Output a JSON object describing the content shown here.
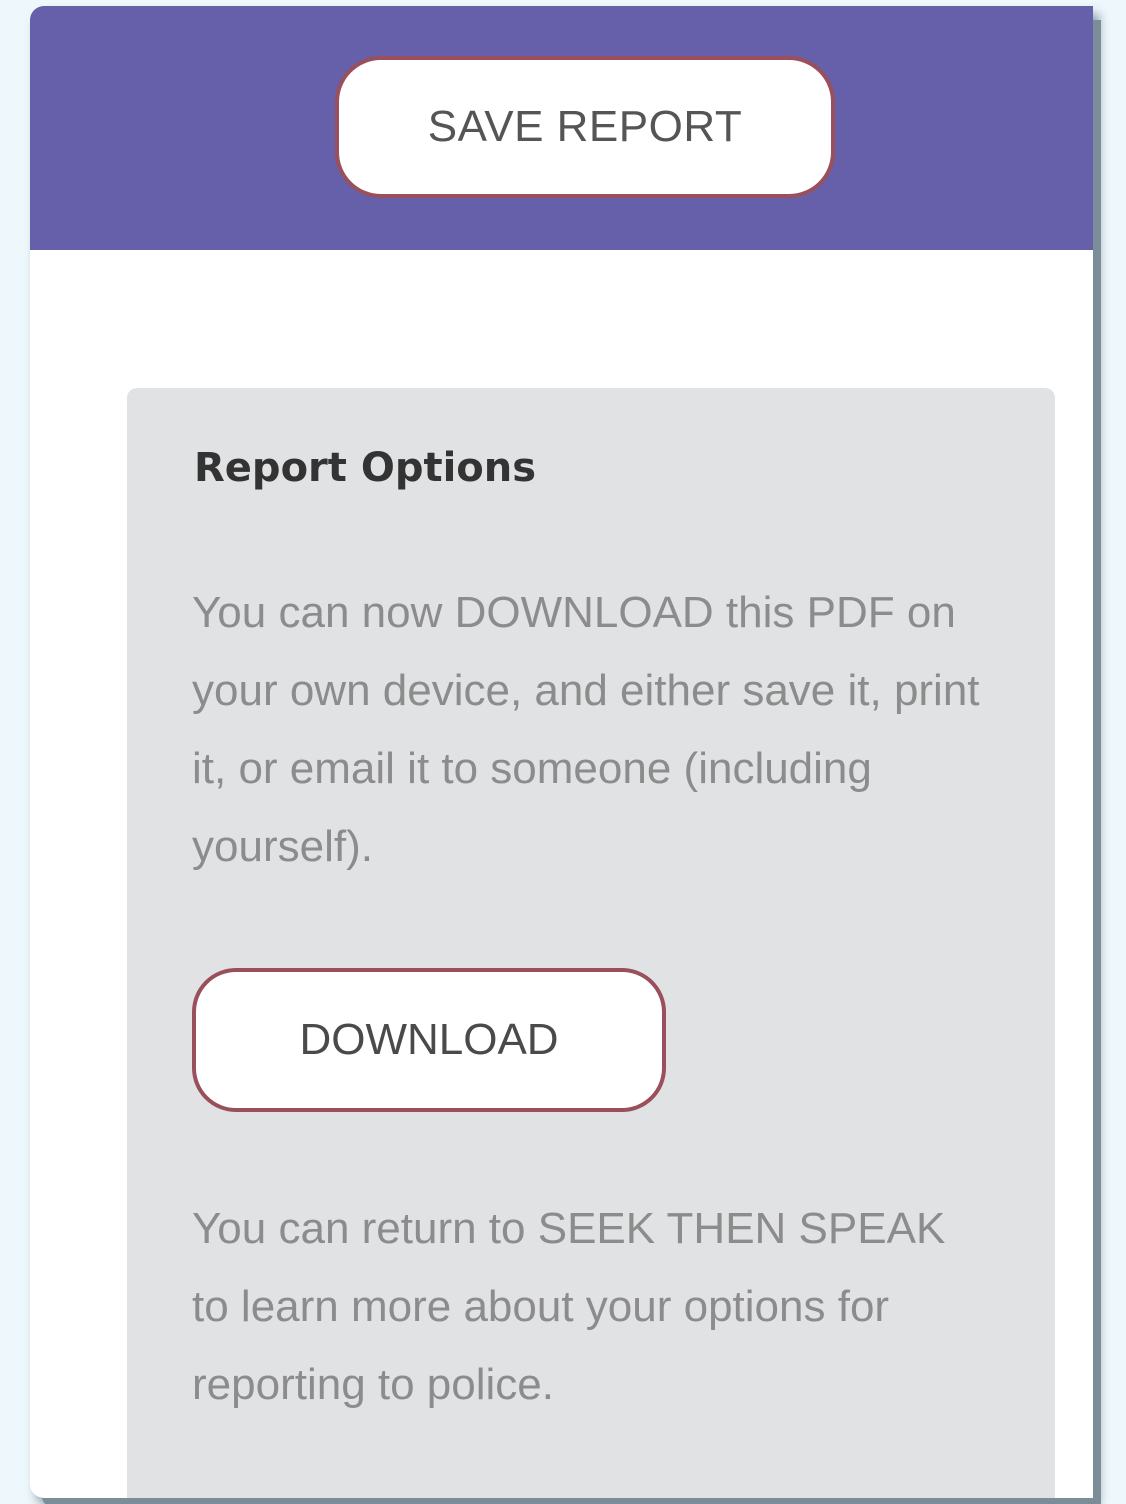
{
  "header": {
    "save_label": "SAVE REPORT"
  },
  "options": {
    "title": "Report Options",
    "download_text": "You can now DOWNLOAD this PDF on your own device, and either save it, print it, or email it to someone (including yourself).",
    "download_label": "DOWNLOAD",
    "return_text": "You can return to SEEK THEN SPEAK to learn more about your options for reporting to police."
  },
  "colors": {
    "header_band": "#6560a9",
    "button_border": "#9a4f5c",
    "card_background": "#e1e2e4",
    "page_background": "#edf7fc"
  }
}
